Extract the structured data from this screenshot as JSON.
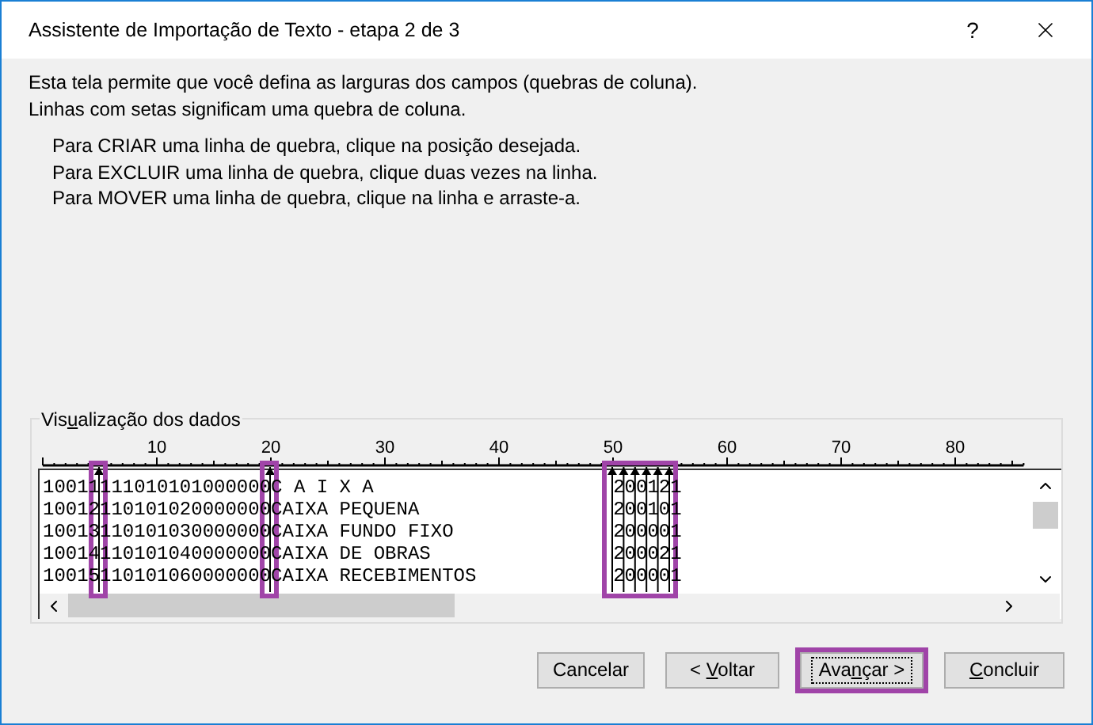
{
  "window": {
    "title": "Assistente de Importação de Texto - etapa 2 de 3",
    "help": "?"
  },
  "intro": [
    "Esta tela permite que você defina as larguras dos campos (quebras de coluna).",
    "Linhas com setas significam uma quebra de coluna."
  ],
  "instructions": [
    "Para CRIAR uma linha de quebra, clique na posição desejada.",
    "Para EXCLUIR uma linha de quebra, clique duas vezes na linha.",
    "Para MOVER uma linha de quebra, clique na linha e arraste-a."
  ],
  "preview": {
    "label": {
      "before": "Vis",
      "key": "u",
      "after": "alização dos dados"
    },
    "ruler_labels": [
      "10",
      "20",
      "30",
      "40",
      "50",
      "60",
      "70",
      "80"
    ],
    "rows": [
      {
        "segments": [
          "10011",
          "111010101000000",
          "C A I X A                     ",
          "2",
          "0",
          "0",
          "1",
          "2",
          "1"
        ]
      },
      {
        "segments": [
          "10012",
          "110101020000000",
          "CAIXA PEQUENA                 ",
          "2",
          "0",
          "0",
          "1",
          "0",
          "1"
        ]
      },
      {
        "segments": [
          "10013",
          "110101030000000",
          "CAIXA FUNDO FIXO              ",
          "2",
          "0",
          "0",
          "0",
          "0",
          "1"
        ]
      },
      {
        "segments": [
          "10014",
          "110101040000000",
          "CAIXA DE OBRAS                ",
          "2",
          "0",
          "0",
          "0",
          "2",
          "1"
        ]
      },
      {
        "segments": [
          "10015",
          "110101060000000",
          "CAIXA RECEBIMENTOS            ",
          "2",
          "0",
          "0",
          "0",
          "0",
          "1"
        ]
      }
    ]
  },
  "buttons": [
    {
      "label": "Cancelar",
      "highlighted": false,
      "focused": false
    },
    {
      "before": "< ",
      "key": "V",
      "after": "oltar",
      "highlighted": false,
      "focused": false
    },
    {
      "before": "Ava",
      "key": "n",
      "after": "çar >",
      "highlighted": true,
      "focused": true
    },
    {
      "key": "C",
      "after": "oncluir",
      "highlighted": false,
      "focused": false
    }
  ]
}
